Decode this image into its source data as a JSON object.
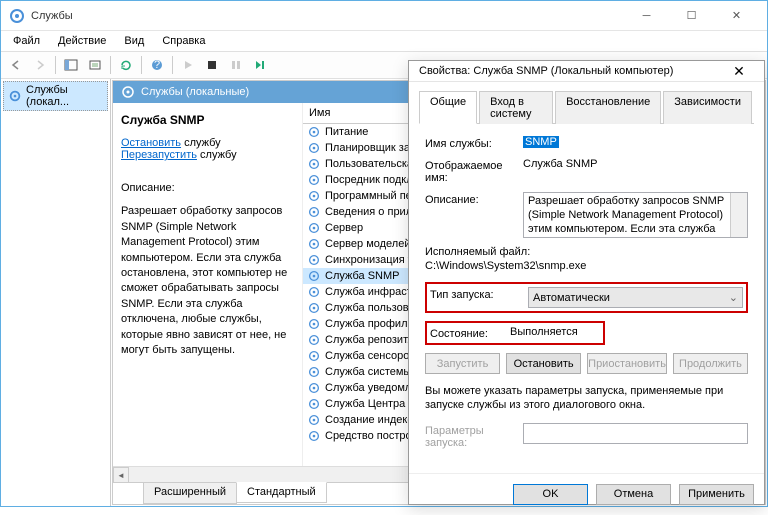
{
  "window": {
    "title": "Службы",
    "menu": [
      "Файл",
      "Действие",
      "Вид",
      "Справка"
    ]
  },
  "tree": {
    "root": "Службы (локал..."
  },
  "pane": {
    "header": "Службы (локальные)",
    "list_header": "Имя",
    "selected_title": "Служба SNMP",
    "link_stop": "Остановить",
    "link_stop_suffix": " службу",
    "link_restart": "Перезапустить",
    "link_restart_suffix": " службу",
    "desc_label": "Описание:",
    "desc_text": "Разрешает обработку запросов SNMP (Simple Network Management Protocol) этим компьютером. Если эта служба остановлена, этот компьютер не сможет обрабатывать запросы SNMP. Если эта служба отключена, любые службы, которые явно зависят от нее, не могут быть запущены.",
    "tabs": {
      "extended": "Расширенный",
      "standard": "Стандартный"
    }
  },
  "services": [
    "Питание",
    "Планировщик зад...",
    "Пользовательска...",
    "Посредник подкл...",
    "Программный пе...",
    "Сведения о прил...",
    "Сервер",
    "Сервер моделей ...",
    "Синхронизация у...",
    "Служба SNMP",
    "Служба инфраст...",
    "Служба пользова...",
    "Служба профиле...",
    "Служба репозит...",
    "Служба сенсоро...",
    "Служба системы...",
    "Служба уведомл...",
    "Служба Центра б...",
    "Создание индекс...",
    "Средство постро..."
  ],
  "dialog": {
    "title": "Свойства: Служба SNMP (Локальный компьютер)",
    "tabs": [
      "Общие",
      "Вход в систему",
      "Восстановление",
      "Зависимости"
    ],
    "labels": {
      "service_name": "Имя службы:",
      "display_name": "Отображаемое имя:",
      "description": "Описание:",
      "exec": "Исполняемый файл:",
      "startup": "Тип запуска:",
      "state": "Состояние:",
      "params": "Параметры запуска:"
    },
    "values": {
      "service_name": "SNMP",
      "display_name": "Служба SNMP",
      "description": "Разрешает обработку запросов SNMP (Simple Network Management Protocol) этим компьютером. Если эта служба остановлена, этот компьютер не сможет обрабатывать",
      "exec": "C:\\Windows\\System32\\snmp.exe",
      "startup": "Автоматически",
      "state": "Выполняется"
    },
    "buttons": {
      "start": "Запустить",
      "stop": "Остановить",
      "pause": "Приостановить",
      "resume": "Продолжить",
      "ok": "OK",
      "cancel": "Отмена",
      "apply": "Применить"
    },
    "hint": "Вы можете указать параметры запуска, применяемые при запуске службы из этого диалогового окна."
  }
}
